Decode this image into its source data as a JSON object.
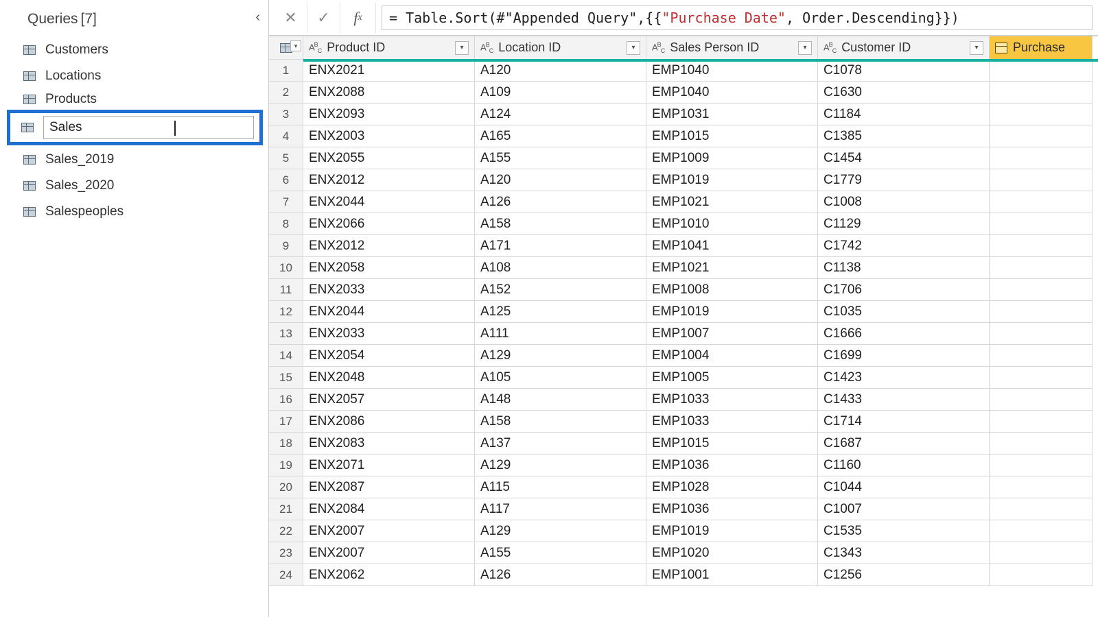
{
  "sidebar": {
    "title": "Queries",
    "count": "[7]",
    "items": [
      {
        "label": "Customers"
      },
      {
        "label": "Locations"
      },
      {
        "label": "Products"
      },
      {
        "label": "Sales",
        "editing": true
      },
      {
        "label": "Sales_2019"
      },
      {
        "label": "Sales_2020"
      },
      {
        "label": "Salespeoples"
      }
    ]
  },
  "formula": {
    "prefix": "= Table.Sort(#\"Appended Query\",{{",
    "redPart": "\"Purchase Date\"",
    "suffix": ", Order.Descending}})"
  },
  "columns": [
    {
      "name": "Product ID"
    },
    {
      "name": "Location ID"
    },
    {
      "name": "Sales Person ID"
    },
    {
      "name": "Customer ID"
    },
    {
      "name": "Purchase",
      "date": true
    }
  ],
  "rows": [
    {
      "n": "1",
      "product": "ENX2021",
      "location": "A120",
      "sales": "EMP1040",
      "customer": "C1078"
    },
    {
      "n": "2",
      "product": "ENX2088",
      "location": "A109",
      "sales": "EMP1040",
      "customer": "C1630"
    },
    {
      "n": "3",
      "product": "ENX2093",
      "location": "A124",
      "sales": "EMP1031",
      "customer": "C1184"
    },
    {
      "n": "4",
      "product": "ENX2003",
      "location": "A165",
      "sales": "EMP1015",
      "customer": "C1385"
    },
    {
      "n": "5",
      "product": "ENX2055",
      "location": "A155",
      "sales": "EMP1009",
      "customer": "C1454"
    },
    {
      "n": "6",
      "product": "ENX2012",
      "location": "A120",
      "sales": "EMP1019",
      "customer": "C1779"
    },
    {
      "n": "7",
      "product": "ENX2044",
      "location": "A126",
      "sales": "EMP1021",
      "customer": "C1008"
    },
    {
      "n": "8",
      "product": "ENX2066",
      "location": "A158",
      "sales": "EMP1010",
      "customer": "C1129"
    },
    {
      "n": "9",
      "product": "ENX2012",
      "location": "A171",
      "sales": "EMP1041",
      "customer": "C1742"
    },
    {
      "n": "10",
      "product": "ENX2058",
      "location": "A108",
      "sales": "EMP1021",
      "customer": "C1138"
    },
    {
      "n": "11",
      "product": "ENX2033",
      "location": "A152",
      "sales": "EMP1008",
      "customer": "C1706"
    },
    {
      "n": "12",
      "product": "ENX2044",
      "location": "A125",
      "sales": "EMP1019",
      "customer": "C1035"
    },
    {
      "n": "13",
      "product": "ENX2033",
      "location": "A111",
      "sales": "EMP1007",
      "customer": "C1666"
    },
    {
      "n": "14",
      "product": "ENX2054",
      "location": "A129",
      "sales": "EMP1004",
      "customer": "C1699"
    },
    {
      "n": "15",
      "product": "ENX2048",
      "location": "A105",
      "sales": "EMP1005",
      "customer": "C1423"
    },
    {
      "n": "16",
      "product": "ENX2057",
      "location": "A148",
      "sales": "EMP1033",
      "customer": "C1433"
    },
    {
      "n": "17",
      "product": "ENX2086",
      "location": "A158",
      "sales": "EMP1033",
      "customer": "C1714"
    },
    {
      "n": "18",
      "product": "ENX2083",
      "location": "A137",
      "sales": "EMP1015",
      "customer": "C1687"
    },
    {
      "n": "19",
      "product": "ENX2071",
      "location": "A129",
      "sales": "EMP1036",
      "customer": "C1160"
    },
    {
      "n": "20",
      "product": "ENX2087",
      "location": "A115",
      "sales": "EMP1028",
      "customer": "C1044"
    },
    {
      "n": "21",
      "product": "ENX2084",
      "location": "A117",
      "sales": "EMP1036",
      "customer": "C1007"
    },
    {
      "n": "22",
      "product": "ENX2007",
      "location": "A129",
      "sales": "EMP1019",
      "customer": "C1535"
    },
    {
      "n": "23",
      "product": "ENX2007",
      "location": "A155",
      "sales": "EMP1020",
      "customer": "C1343"
    },
    {
      "n": "24",
      "product": "ENX2062",
      "location": "A126",
      "sales": "EMP1001",
      "customer": "C1256"
    }
  ]
}
